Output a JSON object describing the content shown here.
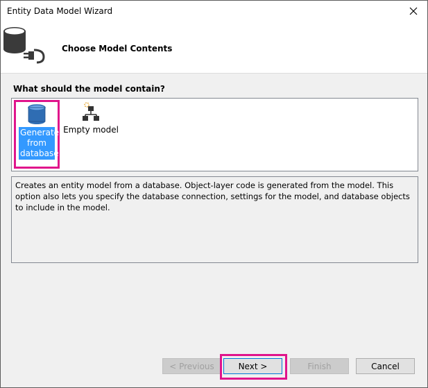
{
  "window": {
    "title": "Entity Data Model Wizard"
  },
  "header": {
    "heading": "Choose Model Contents"
  },
  "question": "What should the model contain?",
  "options": [
    {
      "label": "Generate from database",
      "selected": true,
      "icon": "database-icon"
    },
    {
      "label": "Empty model",
      "selected": false,
      "icon": "model-hierarchy-icon"
    }
  ],
  "description": "Creates an entity model from a database. Object-layer code is generated from the model. This option also lets you specify the database connection, settings for the model, and database objects to include in the model.",
  "buttons": {
    "previous": "< Previous",
    "next": "Next >",
    "finish": "Finish",
    "cancel": "Cancel"
  },
  "colors": {
    "selection": "#3399ff",
    "highlight": "#e0148c",
    "focus": "#0078d7"
  }
}
